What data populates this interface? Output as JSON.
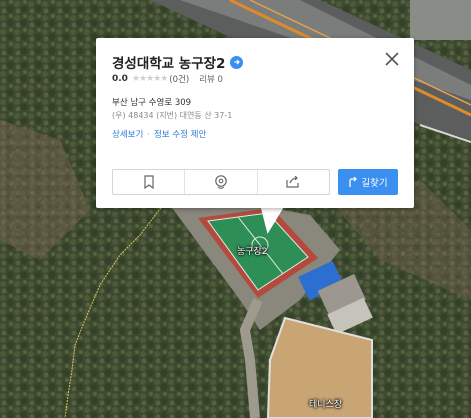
{
  "popup": {
    "title": "경성대학교 농구장2",
    "rating_score": "0.0",
    "rating_count": "(0건)",
    "review_label": "리뷰 0",
    "address_road": "부산 남구 수영로 309",
    "address_jibun": "(우) 48434  (지번) 대연동 산 37-1",
    "link_detail": "상세보기",
    "link_separator": "·",
    "link_edit": "정보 수정 제안",
    "route_label": "길찾기",
    "icons": [
      "bookmark-icon",
      "pin-icon",
      "share-icon",
      "route-icon"
    ]
  },
  "map_labels": {
    "court": "농구장2",
    "tennis": "테니스장"
  },
  "colors": {
    "route_button": "#3a8ff0",
    "link": "#2f7bd9",
    "court_green": "#2e8f56",
    "court_red": "#b34a3c"
  }
}
